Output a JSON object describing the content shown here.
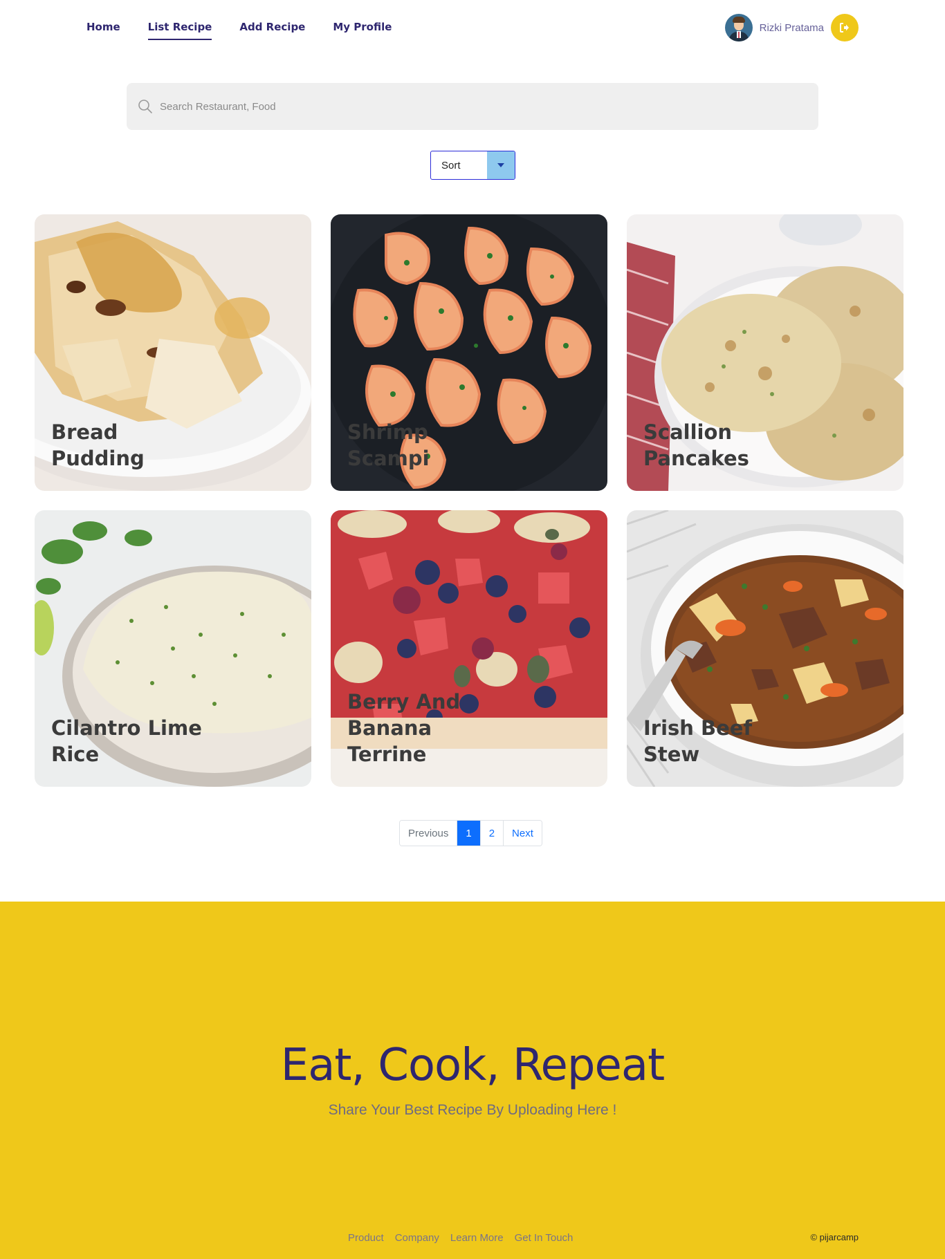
{
  "nav": {
    "links": [
      {
        "label": "Home"
      },
      {
        "label": "List Recipe"
      },
      {
        "label": "Add Recipe"
      },
      {
        "label": "My Profile"
      }
    ],
    "user_name": "Rizki Pratama"
  },
  "search": {
    "placeholder": "Search Restaurant, Food"
  },
  "sort": {
    "label": "Sort"
  },
  "recipes": [
    {
      "title": "Bread Pudding"
    },
    {
      "title": "Shrimp Scampi"
    },
    {
      "title": "Scallion Pancakes"
    },
    {
      "title": "Cilantro Lime Rice"
    },
    {
      "title": "Berry And Banana Terrine"
    },
    {
      "title": "Irish Beef Stew"
    }
  ],
  "pagination": {
    "previous": "Previous",
    "pages": [
      "1",
      "2"
    ],
    "next": "Next",
    "current": "1"
  },
  "footer": {
    "title": "Eat, Cook, Repeat",
    "subtitle": "Share Your Best Recipe By Uploading Here !",
    "links": [
      "Product",
      "Company",
      "Learn More",
      "Get In Touch"
    ],
    "copyright": "© pijarcamp"
  },
  "colors": {
    "accent": "#efc81a",
    "brand": "#2e266f",
    "link": "#0d6efd"
  }
}
